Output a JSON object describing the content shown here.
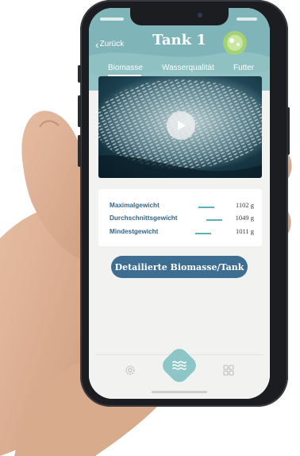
{
  "header": {
    "back_label": "Zurück",
    "title": "Tank 1",
    "accent_color": "#8dbfc3"
  },
  "tabs": [
    {
      "label": "Biomasse",
      "active": true
    },
    {
      "label": "Wasserqualität",
      "active": false
    },
    {
      "label": "Futter",
      "active": false
    }
  ],
  "video": {
    "play_icon": "play-icon"
  },
  "stats": [
    {
      "label": "Maximalgewicht",
      "value": "1102 g"
    },
    {
      "label": "Durchschnittsgewicht",
      "value": "1049 g"
    },
    {
      "label": "Mindestgewicht",
      "value": "1011 g"
    }
  ],
  "action_button": {
    "label": "Detailierte Biomasse/Tank",
    "color": "#3e6d92"
  },
  "bottom_nav": {
    "left_icon": "gear-icon",
    "center_icon": "waves-icon",
    "right_icon": "grid-icon",
    "fab_color": "#8cc6c6"
  }
}
